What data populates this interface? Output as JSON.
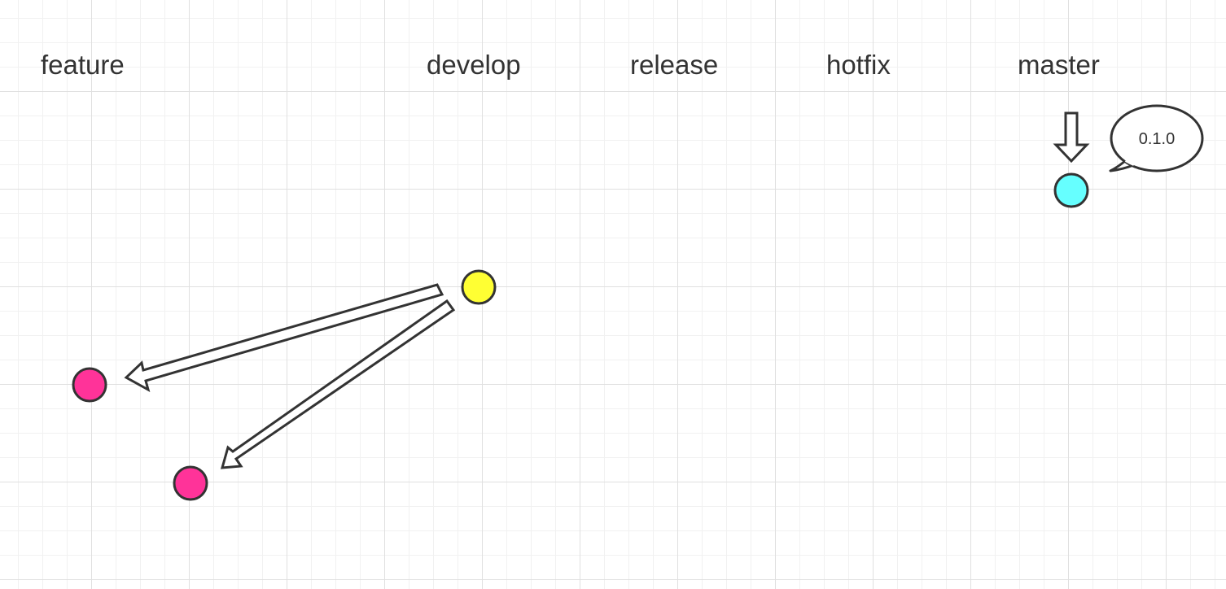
{
  "lanes": {
    "feature": "feature",
    "develop": "develop",
    "release": "release",
    "hotfix": "hotfix",
    "master": "master"
  },
  "tag": {
    "label": "0.1.0"
  },
  "colors": {
    "feature_commit": "#ff3399",
    "develop_commit": "#ffff33",
    "master_commit": "#66ffff",
    "outline": "#333333"
  }
}
